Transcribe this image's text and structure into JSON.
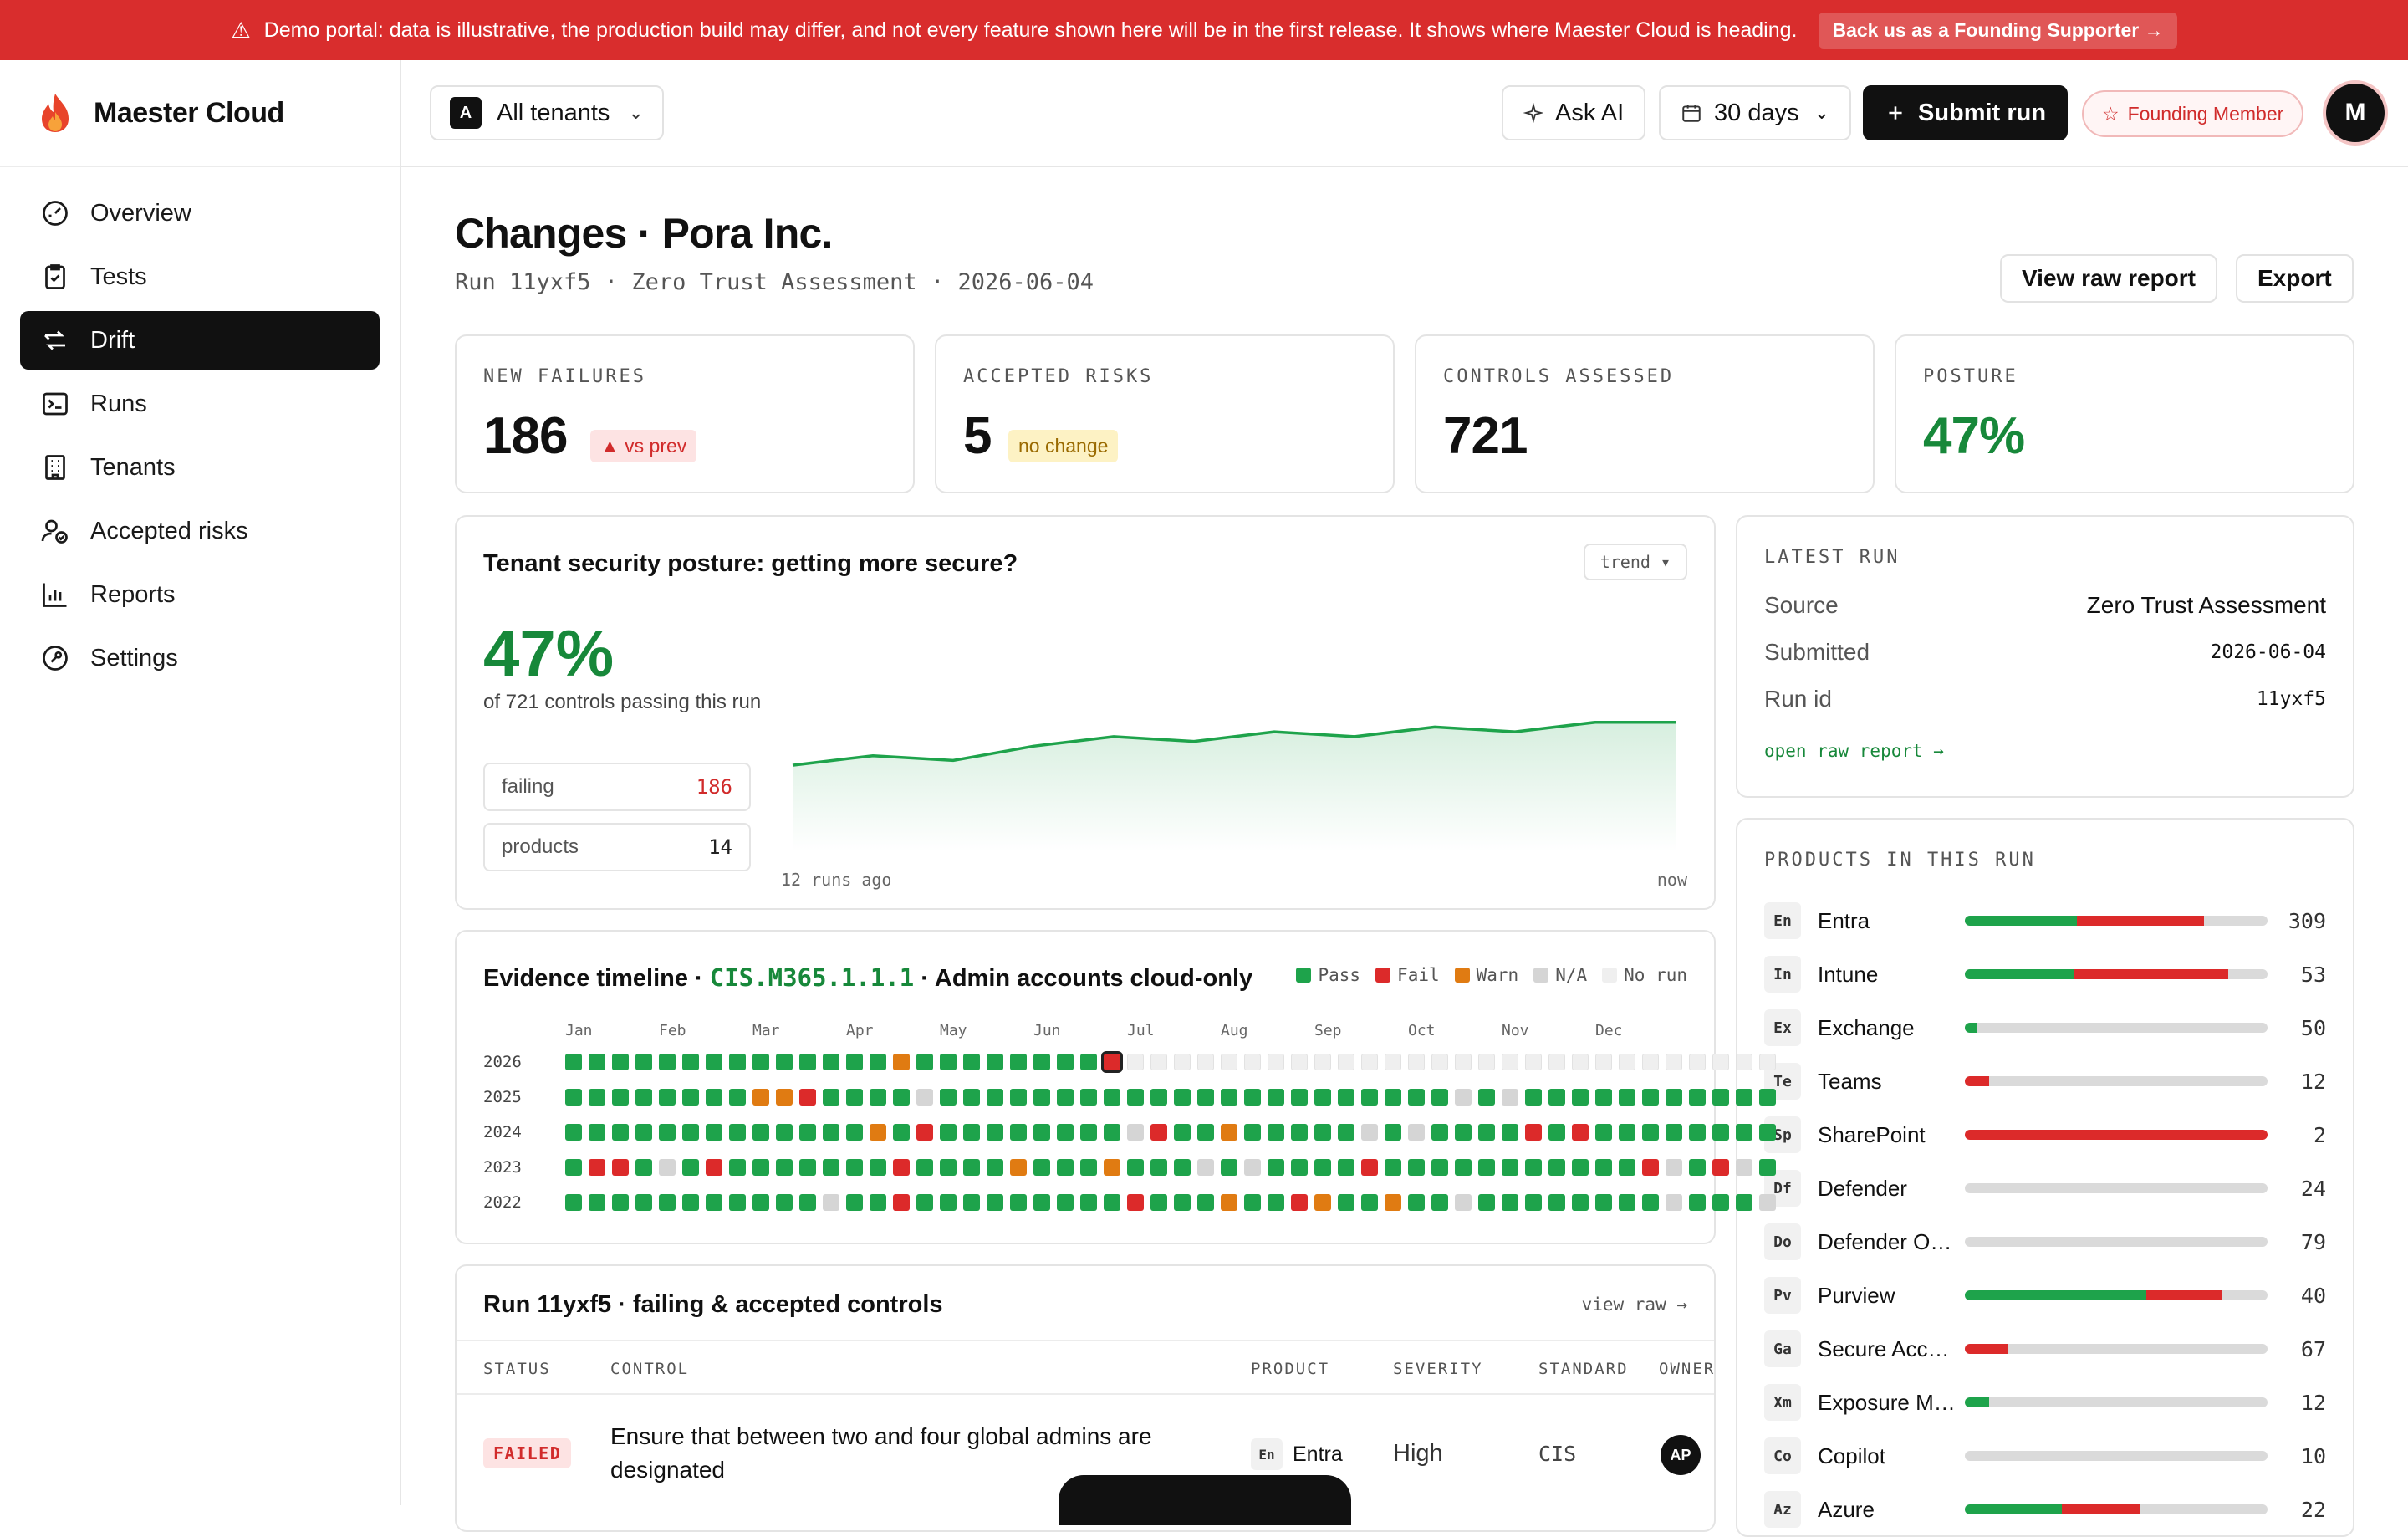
{
  "banner": {
    "text": "Demo portal: data is illustrative, the production build may differ, and not every feature shown here will be in the first release. It shows where Maester Cloud is heading.",
    "cta": "Back us as a Founding Supporter →"
  },
  "brand": {
    "name": "Maester Cloud"
  },
  "nav": [
    {
      "label": "Overview",
      "icon": "gauge-icon"
    },
    {
      "label": "Tests",
      "icon": "clipboard-check-icon"
    },
    {
      "label": "Drift",
      "icon": "arrows-drift-icon",
      "active": true
    },
    {
      "label": "Runs",
      "icon": "terminal-icon"
    },
    {
      "label": "Tenants",
      "icon": "building-icon"
    },
    {
      "label": "Accepted risks",
      "icon": "users-check-icon"
    },
    {
      "label": "Reports",
      "icon": "bar-chart-icon"
    },
    {
      "label": "Settings",
      "icon": "wrench-icon"
    }
  ],
  "topbar": {
    "tenant_badge": "A",
    "tenant_label": "All tenants",
    "ask_ai": "Ask AI",
    "range": "30 days",
    "submit": "Submit run",
    "founding": "Founding Member",
    "avatar": "M"
  },
  "page": {
    "title": "Changes · Pora Inc.",
    "subtitle": "Run 11yxf5 · Zero Trust Assessment · 2026-06-04",
    "view_raw": "View raw report",
    "export": "Export"
  },
  "kpis": [
    {
      "label": "NEW FAILURES",
      "value": "186",
      "chip": "▲ vs prev",
      "chip_color": "red"
    },
    {
      "label": "ACCEPTED RISKS",
      "value": "5",
      "chip": "no change",
      "chip_color": "yellow"
    },
    {
      "label": "CONTROLS ASSESSED",
      "value": "721"
    },
    {
      "label": "POSTURE",
      "value": "47%",
      "value_color": "#17883a"
    }
  ],
  "posture": {
    "title": "Tenant security posture: getting more secure?",
    "toggle": "trend ▾",
    "value": "47%",
    "caption": "of 721 controls passing this run",
    "failing_label": "failing",
    "failing_value": "186",
    "products_label": "products",
    "products_value": "14",
    "axis_left": "12 runs ago",
    "axis_right": "now"
  },
  "chart_data": {
    "type": "area",
    "x": [
      1,
      2,
      3,
      4,
      5,
      6,
      7,
      8,
      9,
      10,
      11,
      12
    ],
    "values": [
      38,
      40,
      39,
      42,
      44,
      43,
      45,
      44,
      46,
      45,
      47,
      47
    ],
    "ylim": [
      20,
      55
    ],
    "color": "#1ea34b"
  },
  "latest": {
    "label": "LATEST RUN",
    "rows": [
      {
        "k": "Source",
        "v": "Zero Trust Assessment"
      },
      {
        "k": "Submitted",
        "v": "2026-06-04"
      },
      {
        "k": "Run id",
        "v": "11yxf5"
      }
    ],
    "link": "open raw report →"
  },
  "products": {
    "label": "PRODUCTS IN THIS RUN",
    "items": [
      {
        "abbr": "En",
        "name": "Entra",
        "pass": 0.37,
        "fail": 0.42,
        "count": "309"
      },
      {
        "abbr": "In",
        "name": "Intune",
        "pass": 0.36,
        "fail": 0.51,
        "count": "53"
      },
      {
        "abbr": "Ex",
        "name": "Exchange",
        "pass": 0.04,
        "fail": 0.0,
        "count": "50"
      },
      {
        "abbr": "Te",
        "name": "Teams",
        "pass": 0.0,
        "fail": 0.08,
        "count": "12"
      },
      {
        "abbr": "Sp",
        "name": "SharePoint",
        "pass": 0.0,
        "fail": 1.0,
        "count": "2"
      },
      {
        "abbr": "Df",
        "name": "Defender",
        "pass": 0.0,
        "fail": 0.0,
        "count": "24"
      },
      {
        "abbr": "Do",
        "name": "Defender O…",
        "pass": 0.0,
        "fail": 0.0,
        "count": "79"
      },
      {
        "abbr": "Pv",
        "name": "Purview",
        "pass": 0.6,
        "fail": 0.25,
        "count": "40"
      },
      {
        "abbr": "Ga",
        "name": "Secure Acc…",
        "pass": 0.0,
        "fail": 0.14,
        "count": "67"
      },
      {
        "abbr": "Xm",
        "name": "Exposure M…",
        "pass": 0.08,
        "fail": 0.0,
        "count": "12"
      },
      {
        "abbr": "Co",
        "name": "Copilot",
        "pass": 0.0,
        "fail": 0.0,
        "count": "10"
      },
      {
        "abbr": "Az",
        "name": "Azure",
        "pass": 0.32,
        "fail": 0.26,
        "count": "22"
      }
    ]
  },
  "timeline": {
    "title_a": "Evidence timeline · ",
    "control_id": "CIS.M365.1.1.1",
    "title_b": " · Admin accounts cloud-only",
    "legend": [
      "Pass",
      "Fail",
      "Warn",
      "N/A",
      "No run"
    ],
    "legend_colors": [
      "#1ea34b",
      "#dc2a2a",
      "#e07b12",
      "#d5d5d5",
      "#efefef"
    ],
    "months": [
      "Jan",
      "Feb",
      "Mar",
      "Apr",
      "May",
      "Jun",
      "Jul",
      "Aug",
      "Sep",
      "Oct",
      "Nov",
      "Dec"
    ],
    "years": [
      "2026",
      "2025",
      "2024",
      "2023",
      "2022"
    ],
    "rows": [
      "PPPPPPPPPPPPPPWPPPPPPPPFNNNNNNNNNNNNNNNNNNNNNNNNNNNN",
      "PPPPPPPPWWFPPPPXPPPPPPPPPPPPPPPPPPPPPPXPXPPPPPPPPPPP",
      "PPPPPPPPPPPPPWPFPPPPPPPPXFPPWPPPPPXPXPPPPFPFPPPPPPPP",
      "PFFPXPFPPPPPPPFPPPPWPPPWPPPXPXPPPPFPPPPPPPPPPPFXPFXP",
      "PPPPPPPPPPPXPPFPPPPPPPPPFPPPWPPFWPPWPPXPPPPPPPPXPPPX"
    ]
  },
  "controls": {
    "title": "Run 11yxf5 · failing & accepted controls",
    "view_raw": "view raw →",
    "headers": [
      "STATUS",
      "CONTROL",
      "PRODUCT",
      "SEVERITY",
      "STANDARD",
      "OWNER"
    ],
    "row": {
      "status": "FAILED",
      "control": "Ensure that between two and four global admins are designated",
      "product_abbr": "En",
      "product": "Entra",
      "severity": "High",
      "standard": "CIS",
      "owner": "AP"
    }
  }
}
